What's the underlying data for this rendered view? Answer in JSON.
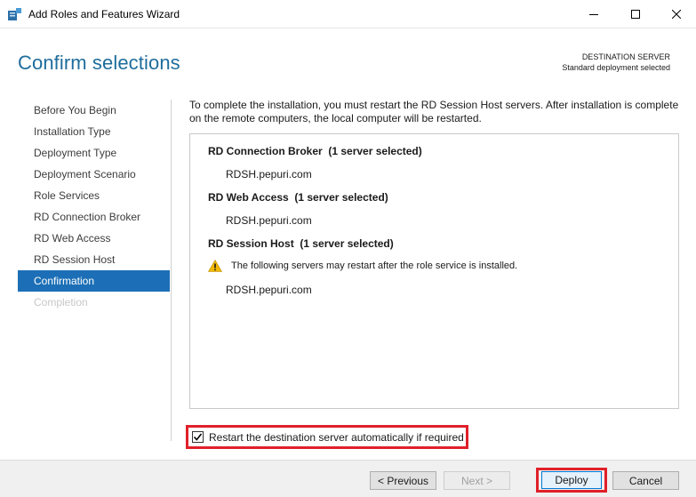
{
  "window": {
    "title": "Add Roles and Features Wizard"
  },
  "header": {
    "page_title": "Confirm selections",
    "destination_label": "DESTINATION SERVER",
    "destination_value": "Standard deployment selected"
  },
  "nav": {
    "items": [
      {
        "label": "Before You Begin",
        "state": "normal"
      },
      {
        "label": "Installation Type",
        "state": "normal"
      },
      {
        "label": "Deployment Type",
        "state": "normal"
      },
      {
        "label": "Deployment Scenario",
        "state": "normal"
      },
      {
        "label": "Role Services",
        "state": "normal"
      },
      {
        "label": "RD Connection Broker",
        "state": "normal"
      },
      {
        "label": "RD Web Access",
        "state": "normal"
      },
      {
        "label": "RD Session Host",
        "state": "normal"
      },
      {
        "label": "Confirmation",
        "state": "active"
      },
      {
        "label": "Completion",
        "state": "disabled"
      }
    ]
  },
  "content": {
    "intro": "To complete the installation, you must restart the RD Session Host servers. After installation is complete on the remote computers, the local computer will be restarted.",
    "sections": [
      {
        "title": "RD Connection Broker",
        "subtitle": "(1 server selected)",
        "server": "RDSH.pepuri.com"
      },
      {
        "title": "RD Web Access",
        "subtitle": "(1 server selected)",
        "server": "RDSH.pepuri.com"
      },
      {
        "title": "RD Session Host",
        "subtitle": "(1 server selected)",
        "warning": "The following servers may restart after the role service is installed.",
        "server": "RDSH.pepuri.com"
      }
    ],
    "restart_checkbox": {
      "label": "Restart the destination server automatically if required",
      "checked": true
    }
  },
  "footer": {
    "previous_label": "< Previous",
    "next_label": "Next >",
    "deploy_label": "Deploy",
    "cancel_label": "Cancel"
  },
  "colors": {
    "title_blue": "#1f6d9c",
    "nav_active_bg": "#1c6fb6",
    "highlight_red": "#e0202a",
    "warning_yellow": "#f2b800"
  },
  "icons": {
    "app": "server-manager-icon",
    "warning": "warning-triangle-icon",
    "check": "checkmark-icon"
  }
}
